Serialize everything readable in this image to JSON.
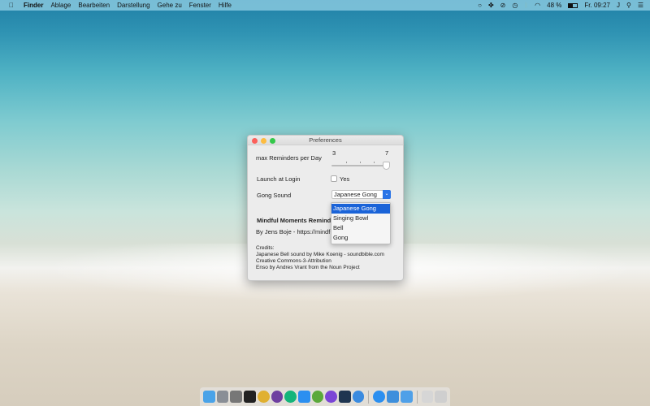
{
  "menubar": {
    "apple": "",
    "app": "Finder",
    "items": [
      "Ablage",
      "Bearbeiten",
      "Darstellung",
      "Gehe zu",
      "Fenster",
      "Hilfe"
    ],
    "battery": "48 %",
    "clock": "Fr. 09:27",
    "user": "J"
  },
  "window": {
    "title": "Preferences",
    "max_reminders_label": "max Reminders per Day",
    "slider_min": "3",
    "slider_max": "7",
    "slider_value": 7,
    "launch_label": "Launch at Login",
    "launch_checkbox": "Yes",
    "launch_checked": false,
    "gong_label": "Gong Sound",
    "gong_value": "Japanese Gong",
    "gong_options": [
      "Japanese Gong",
      "Singing Bowl",
      "Bell",
      "Gong"
    ],
    "app_name": "Mindful Moments Remind",
    "author": "By Jens Boje - https://mindf",
    "credits": [
      "Credits:",
      "Japanese Bell sound by Mike Koenig - soundbible.com",
      "Creative Commons-3-Attribution",
      "Enso by Andres Vrant from the Noun Project"
    ]
  },
  "dock": {
    "apps": [
      {
        "name": "finder",
        "color": "#4aa3e8"
      },
      {
        "name": "launchpad",
        "color": "#8a8f96"
      },
      {
        "name": "system-preferences",
        "color": "#777"
      },
      {
        "name": "terminal",
        "color": "#222"
      },
      {
        "name": "chrome",
        "color": "#e0b030"
      },
      {
        "name": "github",
        "color": "#6e3fa0"
      },
      {
        "name": "grammarly",
        "color": "#15b57a"
      },
      {
        "name": "lingo",
        "color": "#2b8ff0"
      },
      {
        "name": "spring",
        "color": "#5ba93a"
      },
      {
        "name": "app-purple",
        "color": "#7b45d6"
      },
      {
        "name": "vscode",
        "color": "#1f3550"
      },
      {
        "name": "tableplus",
        "color": "#3a8be0"
      },
      {
        "name": "app-store",
        "color": "#2b8ff0"
      },
      {
        "name": "xcode",
        "color": "#3e8fdc"
      },
      {
        "name": "folder",
        "color": "#4fa0e8"
      },
      {
        "name": "documents",
        "color": "#d6d6d6"
      },
      {
        "name": "trash",
        "color": "#cfcfcf"
      }
    ]
  }
}
